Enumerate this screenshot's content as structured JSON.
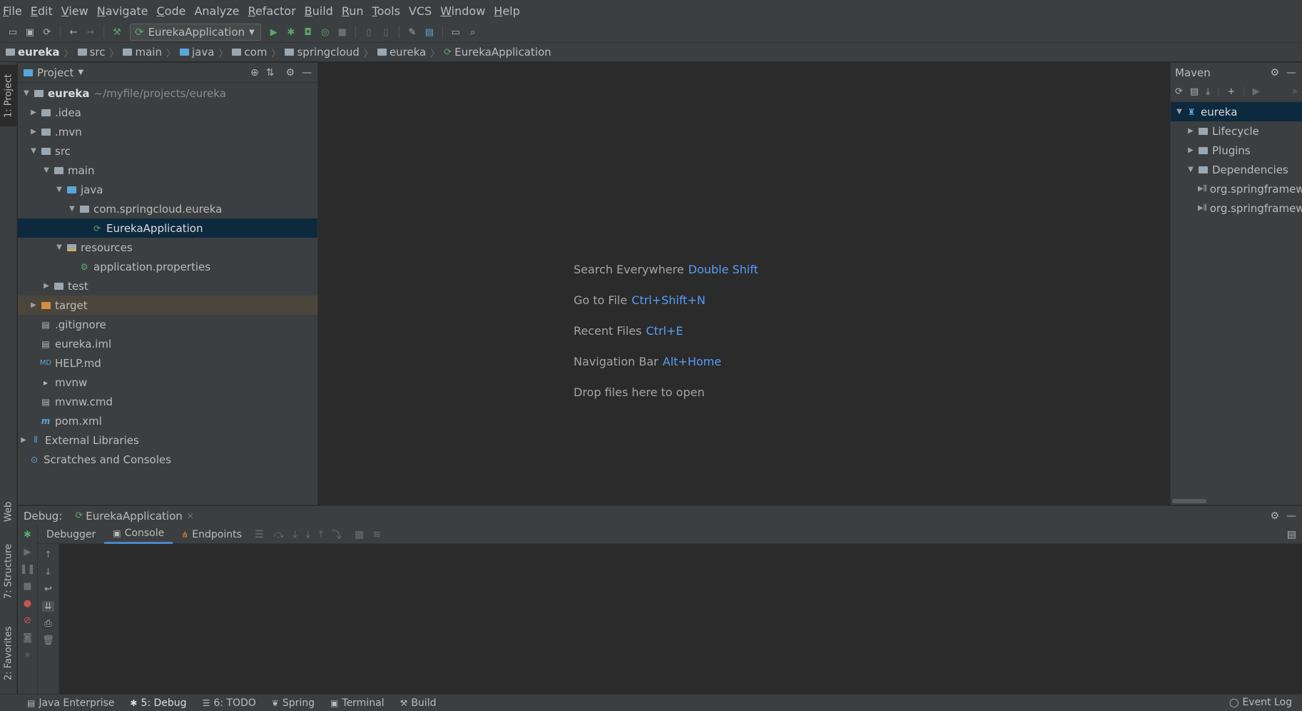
{
  "menu": [
    {
      "u": "F",
      "rest": "ile"
    },
    {
      "u": "E",
      "rest": "dit"
    },
    {
      "u": "V",
      "rest": "iew"
    },
    {
      "u": "N",
      "rest": "avigate"
    },
    {
      "u": "C",
      "rest": "ode"
    },
    {
      "u": "",
      "rest": "Analyze"
    },
    {
      "u": "R",
      "rest": "efactor"
    },
    {
      "u": "B",
      "rest": "uild"
    },
    {
      "u": "R",
      "rest": "un"
    },
    {
      "u": "T",
      "rest": "ools"
    },
    {
      "u": "",
      "rest": "VCS"
    },
    {
      "u": "W",
      "rest": "indow"
    },
    {
      "u": "H",
      "rest": "elp"
    }
  ],
  "toolbar": {
    "run_config": "EurekaApplication"
  },
  "breadcrumb": [
    "eureka",
    "src",
    "main",
    "java",
    "com",
    "springcloud",
    "eureka",
    "EurekaApplication"
  ],
  "left_strip": {
    "project_tab": "1: Project",
    "web_tab": "Web",
    "structure_tab": "7: Structure",
    "favorites_tab": "2: Favorites"
  },
  "project_panel": {
    "title": "Project",
    "tree": {
      "root_name": "eureka",
      "root_path": "~/myfile/projects/eureka",
      "idea": ".idea",
      "mvn": ".mvn",
      "src": "src",
      "main": "main",
      "java": "java",
      "package": "com.springcloud.eureka",
      "app_class": "EurekaApplication",
      "resources": "resources",
      "app_props": "application.properties",
      "test": "test",
      "target": "target",
      "gitignore": ".gitignore",
      "iml": "eureka.iml",
      "help": "HELP.md",
      "mvnw": "mvnw",
      "mvnw_cmd": "mvnw.cmd",
      "pom": "pom.xml",
      "external_libraries": "External Libraries",
      "scratches": "Scratches and Consoles"
    }
  },
  "editor": {
    "hints": [
      {
        "label": "Search Everywhere",
        "key": "Double Shift"
      },
      {
        "label": "Go to File",
        "key": "Ctrl+Shift+N"
      },
      {
        "label": "Recent Files",
        "key": "Ctrl+E"
      },
      {
        "label": "Navigation Bar",
        "key": "Alt+Home"
      }
    ],
    "drop_text": "Drop files here to open"
  },
  "maven": {
    "title": "Maven",
    "root": "eureka",
    "lifecycle": "Lifecycle",
    "plugins": "Plugins",
    "dependencies": "Dependencies",
    "dep1": "org.springframework.cloud:spring-cloud-starter-netflix-eureka-server",
    "dep2": "org.springframework.boot:spring-boot-starter-test"
  },
  "debug": {
    "label": "Debug:",
    "session": "EurekaApplication",
    "tabs": [
      "Debugger",
      "Console",
      "Endpoints"
    ]
  },
  "statusbar": {
    "tabs": [
      "Java Enterprise",
      "5: Debug",
      "6: TODO",
      "Spring",
      "Terminal",
      "Build"
    ],
    "event_log": "Event Log"
  },
  "colors": {
    "background": "#2b2b2b",
    "panel": "#3c3f41",
    "selection": "#0d293e",
    "shortcut_blue": "#589df6",
    "run_green": "#59a869"
  }
}
